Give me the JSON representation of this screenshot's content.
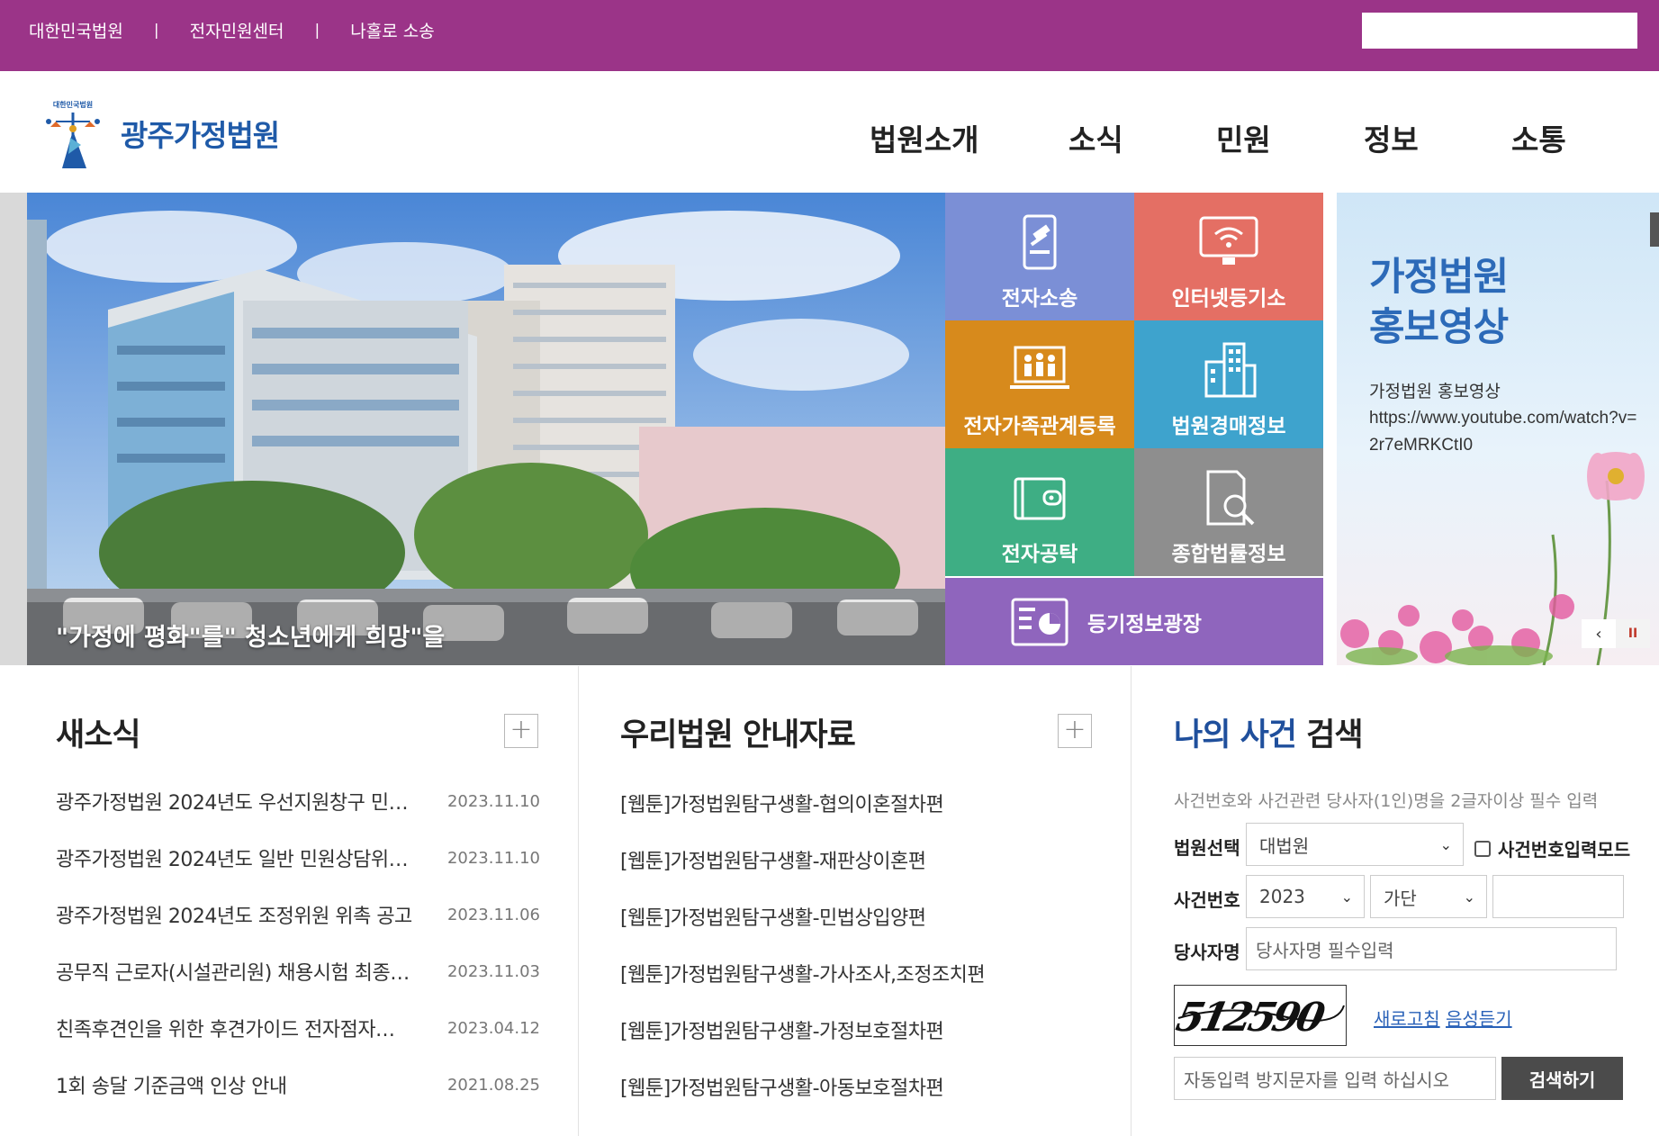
{
  "topbar": {
    "links": [
      "대한민국법원",
      "전자민원센터",
      "나홀로 소송"
    ],
    "separator": "|",
    "search_placeholder": ""
  },
  "header": {
    "logo_text": "광주가정법원",
    "emblem_text": "대한민국법원",
    "nav": [
      "법원소개",
      "소식",
      "민원",
      "정보",
      "소통"
    ]
  },
  "hero": {
    "caption": "\"가정에 평화\"를\" 청소년에게 희망\"을"
  },
  "tiles": [
    {
      "label": "전자소송",
      "icon": "gavel-tablet-icon",
      "color": "#7b8fd6"
    },
    {
      "label": "인터넷등기소",
      "icon": "wifi-monitor-icon",
      "color": "#e46f64"
    },
    {
      "label": "전자가족관계등록",
      "icon": "family-laptop-icon",
      "color": "#d78a1c"
    },
    {
      "label": "법원경매정보",
      "icon": "buildings-icon",
      "color": "#3ea3cd"
    },
    {
      "label": "전자공탁",
      "icon": "wallet-icon",
      "color": "#3eae84"
    },
    {
      "label": "종합법률정보",
      "icon": "document-search-icon",
      "color": "#8e8e8e"
    }
  ],
  "tile_wide": {
    "label": "등기정보광장",
    "icon": "chart-report-icon",
    "color": "#8f65bd"
  },
  "promo": {
    "title_line1": "가정법원",
    "title_line2": "홍보영상",
    "sub_title": "가정법원 홍보영상",
    "sub_url": "https://www.youtube.com/watch?v=2r7eMRKCtI0",
    "prev": "‹",
    "pause": "II"
  },
  "news": {
    "title": "새소식",
    "plus": "+",
    "items": [
      {
        "title": "광주가정법원 2024년도 우선지원창구 민…",
        "date": "2023.11.10"
      },
      {
        "title": "광주가정법원 2024년도 일반 민원상담위…",
        "date": "2023.11.10"
      },
      {
        "title": "광주가정법원 2024년도 조정위원 위촉 공고",
        "date": "2023.11.06"
      },
      {
        "title": "공무직 근로자(시설관리원) 채용시험 최종…",
        "date": "2023.11.03"
      },
      {
        "title": "친족후견인을 위한 후견가이드 전자점자…",
        "date": "2023.04.12"
      },
      {
        "title": "1회 송달 기준금액 인상 안내",
        "date": "2021.08.25"
      }
    ]
  },
  "guide": {
    "title": "우리법원 안내자료",
    "plus": "+",
    "items": [
      "[웹툰]가정법원탐구생활-협의이혼절차편",
      "[웹툰]가정법원탐구생활-재판상이혼편",
      "[웹툰]가정법원탐구생활-민법상입양편",
      "[웹툰]가정법원탐구생활-가사조사,조정조치편",
      "[웹툰]가정법원탐구생활-가정보호절차편",
      "[웹툰]가정법원탐구생활-아동보호절차편"
    ]
  },
  "case_search": {
    "title_a": "나의 사건",
    "title_b": " 검색",
    "notice": "사건번호와 사건관련 당사자(1인)명을 2글자이상 필수 입력",
    "court_label": "법원선택",
    "court_value": "대법원",
    "case_mode_label": "사건번호입력모드",
    "case_no_label": "사건번호",
    "year_value": "2023",
    "type_value": "가단",
    "case_no_value": "",
    "party_label": "당사자명",
    "party_placeholder": "당사자명 필수입력",
    "captcha_text": "512590",
    "refresh_label": "새로고침",
    "audio_label": "음성듣기",
    "captcha_placeholder": "자동입력 방지문자를 입력 하십시오",
    "search_button": "검색하기",
    "chevron": "⌄"
  }
}
